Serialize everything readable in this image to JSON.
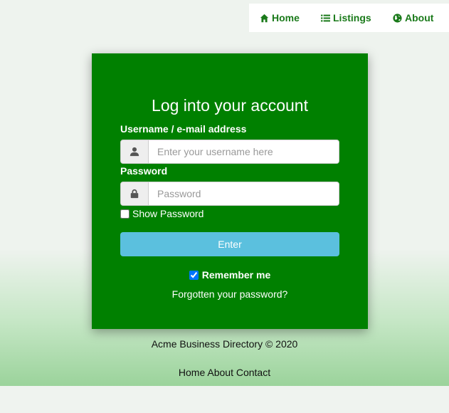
{
  "nav": {
    "items": [
      {
        "label": "Home",
        "icon": "home-icon"
      },
      {
        "label": "Listings",
        "icon": "list-icon"
      },
      {
        "label": "About",
        "icon": "globe-icon"
      }
    ]
  },
  "login": {
    "title": "Log into your account",
    "username_label": "Username / e-mail address",
    "username_placeholder": "Enter your username here",
    "username_icon": "user-icon",
    "password_label": "Password",
    "password_placeholder": "Password",
    "password_icon": "lock-icon",
    "show_password_label": "Show Password",
    "show_password_checked": false,
    "enter_label": "Enter",
    "remember_label": "Remember me",
    "remember_checked": true,
    "forgot_label": "Forgotten your password?"
  },
  "footer": {
    "copyright": "Acme Business Directory © 2020",
    "links": [
      "Home",
      "About",
      "Contact"
    ]
  },
  "colors": {
    "card": "#008000",
    "nav_text": "#1a7a1a",
    "enter_button": "#5bc0de"
  }
}
